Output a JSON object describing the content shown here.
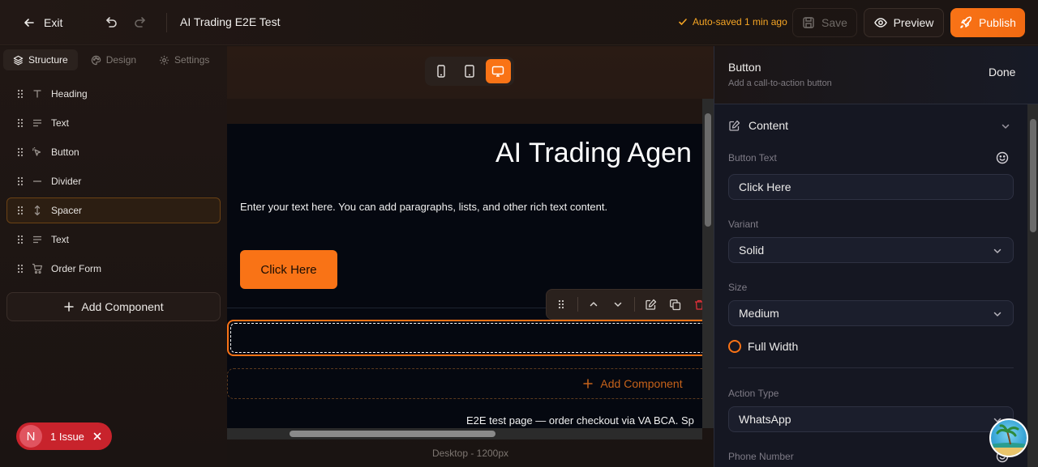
{
  "topbar": {
    "exit_label": "Exit",
    "title": "AI Trading E2E Test",
    "autosave": "Auto-saved 1 min ago",
    "save_label": "Save",
    "preview_label": "Preview",
    "publish_label": "Publish",
    "colors": {
      "accent": "#f97316",
      "autosave": "#f5a524"
    }
  },
  "sidebar": {
    "tabs": [
      {
        "label": "Structure",
        "icon": "layers-icon",
        "active": true
      },
      {
        "label": "Design",
        "icon": "palette-icon",
        "active": false
      },
      {
        "label": "Settings",
        "icon": "gear-icon",
        "active": false
      }
    ],
    "items": [
      {
        "label": "Heading",
        "icon": "heading-icon"
      },
      {
        "label": "Text",
        "icon": "text-lines-icon"
      },
      {
        "label": "Button",
        "icon": "pointer-icon"
      },
      {
        "label": "Divider",
        "icon": "minus-icon"
      },
      {
        "label": "Spacer",
        "icon": "vertical-arrows-icon",
        "selected": true
      },
      {
        "label": "Text",
        "icon": "text-lines-icon"
      },
      {
        "label": "Order Form",
        "icon": "cart-icon"
      }
    ],
    "add_component": "Add Component"
  },
  "issue": {
    "avatar_letter": "N",
    "label": "1 Issue"
  },
  "canvas": {
    "devices": [
      "mobile-icon",
      "tablet-icon",
      "desktop-icon"
    ],
    "active_device": "desktop-icon",
    "hero_title": "AI Trading Agen",
    "hero_text": "Enter your text here. You can add paragraphs, lists, and other rich text content.",
    "hero_button": "Click Here",
    "add_component": "Add Component",
    "footer_text": "E2E test page — order checkout via VA BCA. Sp",
    "caption": "Desktop - 1200px"
  },
  "panel": {
    "title": "Button",
    "subtitle": "Add a call-to-action button",
    "done_label": "Done",
    "section_title": "Content",
    "button_text_label": "Button Text",
    "button_text_value": "Click Here",
    "variant_label": "Variant",
    "variant_value": "Solid",
    "size_label": "Size",
    "size_value": "Medium",
    "full_width_label": "Full Width",
    "action_type_label": "Action Type",
    "action_type_value": "WhatsApp",
    "phone_label": "Phone Number"
  }
}
